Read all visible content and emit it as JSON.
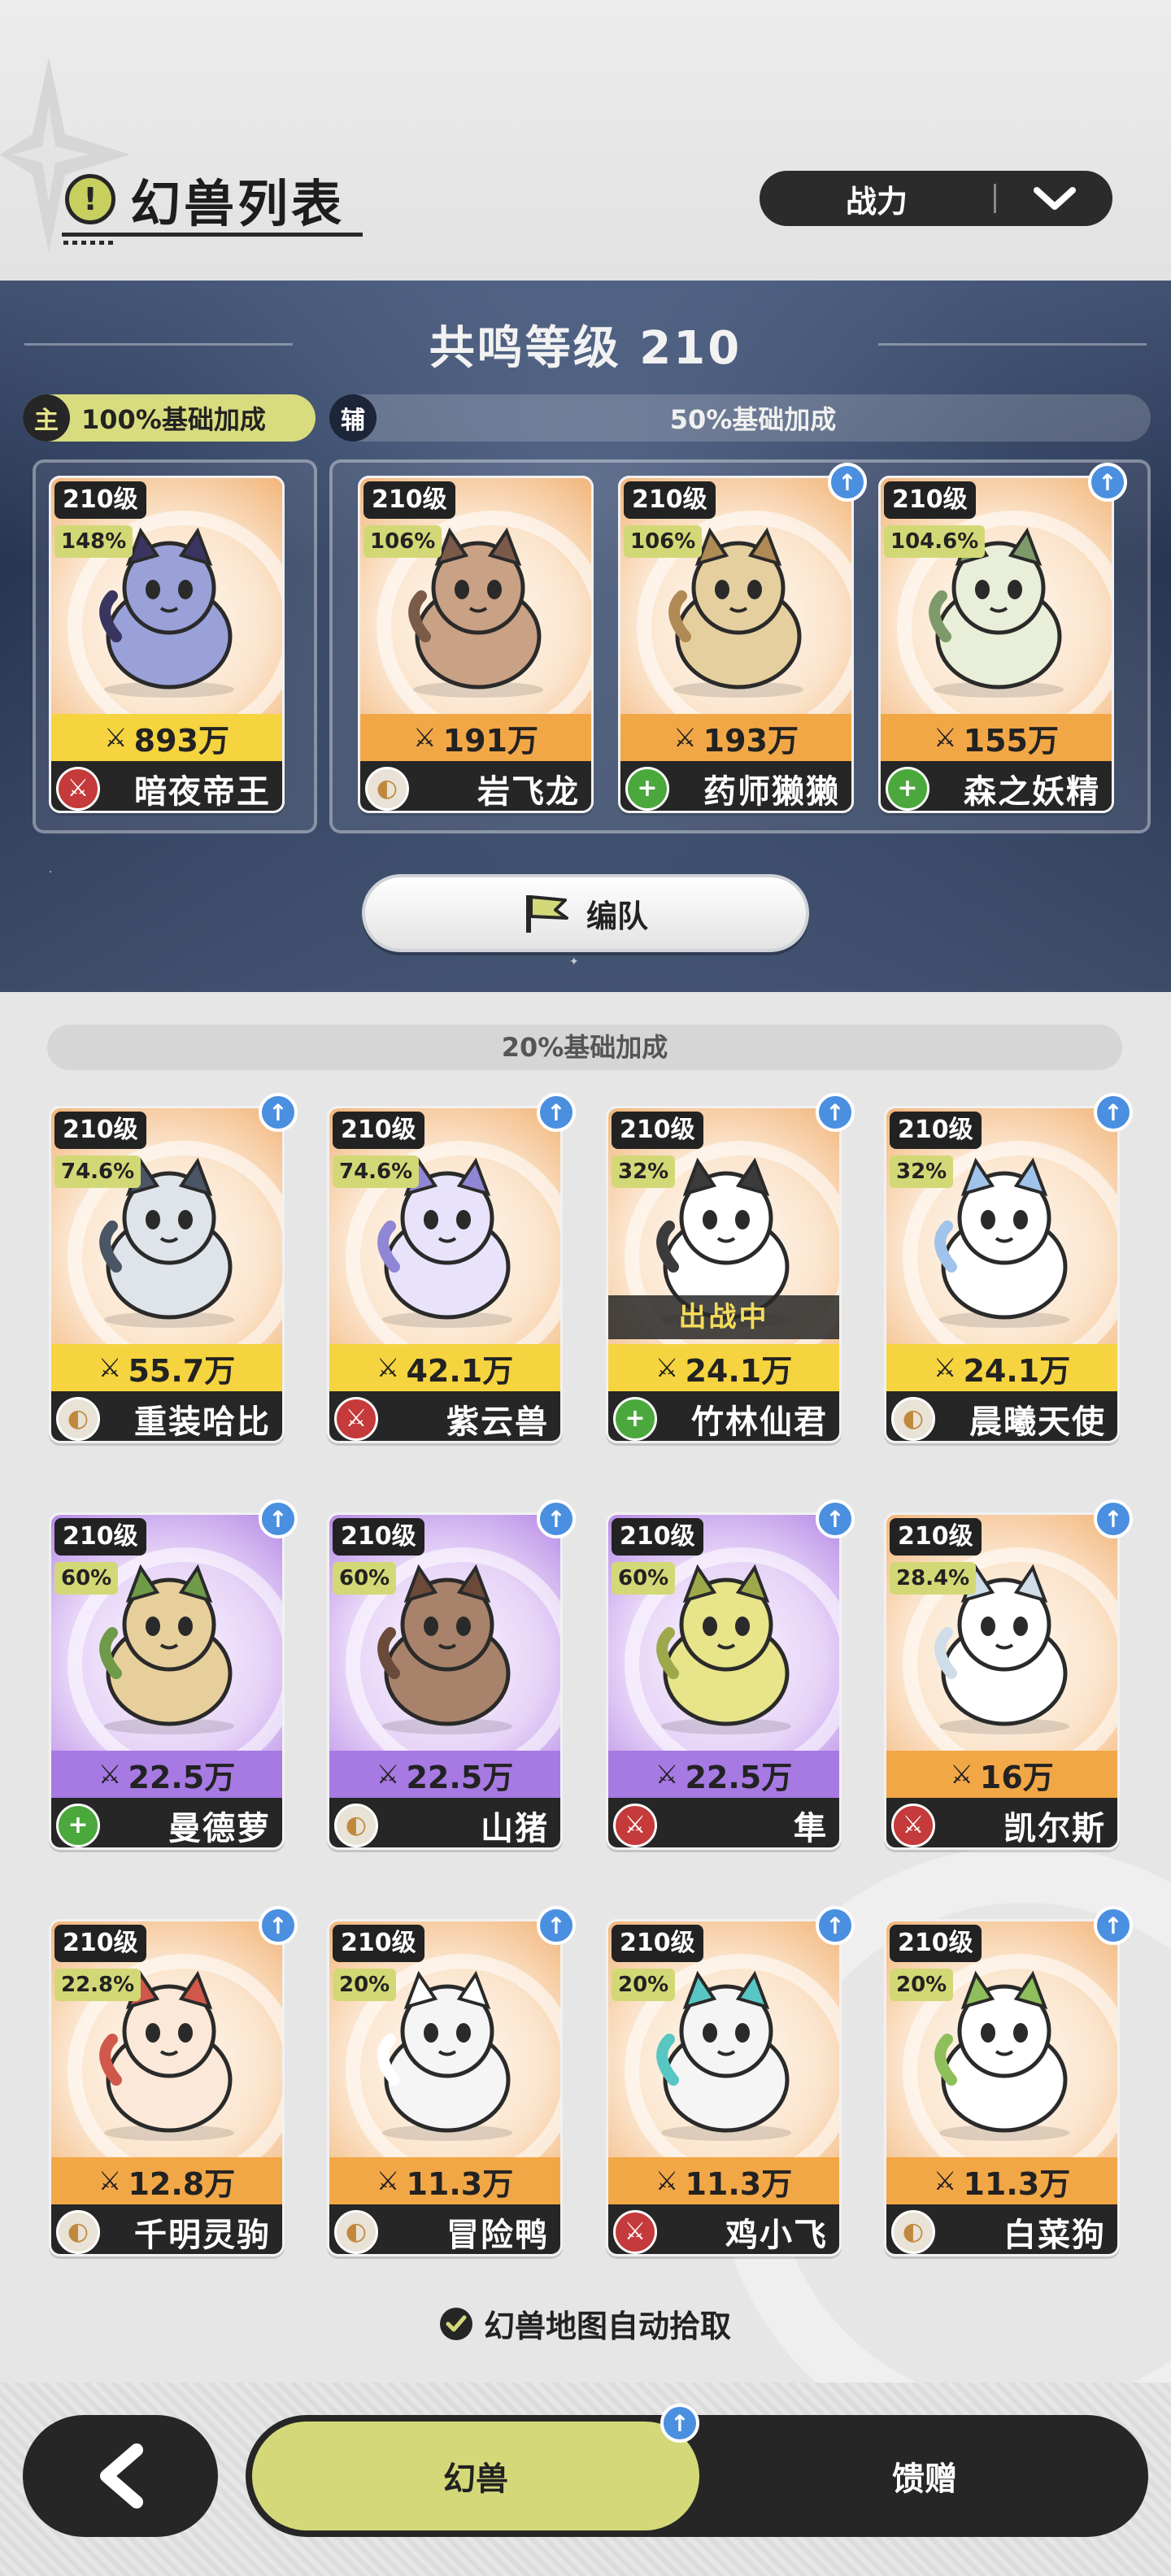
{
  "header": {
    "title": "幻兽列表",
    "info_icon": "exclamation-icon",
    "sort": {
      "label": "战力",
      "icon": "chevron-down-icon"
    }
  },
  "resonance": {
    "title": "共鸣等级 210",
    "main_tag": "主",
    "main_bonus": "100%基础加成",
    "aux_tag": "辅",
    "aux_bonus": "50%基础加成",
    "formation_label": "编队"
  },
  "main_pet": {
    "level": "210级",
    "pct": "148%",
    "power": "893万",
    "name": "暗夜帝王",
    "role": "atk",
    "band": "yellow",
    "bg": "orange",
    "up": false
  },
  "aux_pets": [
    {
      "level": "210级",
      "pct": "106%",
      "power": "191万",
      "name": "岩飞龙",
      "role": "def",
      "band": "orange",
      "bg": "orange",
      "up": false
    },
    {
      "level": "210级",
      "pct": "106%",
      "power": "193万",
      "name": "药师獭獭",
      "role": "heal",
      "band": "orange",
      "bg": "orange",
      "up": true
    },
    {
      "level": "210级",
      "pct": "104.6%",
      "power": "155万",
      "name": "森之妖精",
      "role": "heal",
      "band": "orange",
      "bg": "orange",
      "up": true
    }
  ],
  "reserve": {
    "bonus_label": "20%基础加成",
    "battle_label": "出战中",
    "pets": [
      {
        "level": "210级",
        "pct": "74.6%",
        "power": "55.7万",
        "name": "重装哈比",
        "role": "def",
        "band": "yellow",
        "bg": "orange",
        "up": true
      },
      {
        "level": "210级",
        "pct": "74.6%",
        "power": "42.1万",
        "name": "紫云兽",
        "role": "atk",
        "band": "yellow",
        "bg": "orange",
        "up": true
      },
      {
        "level": "210级",
        "pct": "32%",
        "power": "24.1万",
        "name": "竹林仙君",
        "role": "heal",
        "band": "yellow",
        "bg": "orange",
        "up": true,
        "in_battle": true
      },
      {
        "level": "210级",
        "pct": "32%",
        "power": "24.1万",
        "name": "晨曦天使",
        "role": "def",
        "band": "yellow",
        "bg": "orange",
        "up": true
      },
      {
        "level": "210级",
        "pct": "60%",
        "power": "22.5万",
        "name": "曼德萝",
        "role": "heal",
        "band": "purple",
        "bg": "purple",
        "up": true
      },
      {
        "level": "210级",
        "pct": "60%",
        "power": "22.5万",
        "name": "山猪",
        "role": "def",
        "band": "purple",
        "bg": "purple",
        "up": true
      },
      {
        "level": "210级",
        "pct": "60%",
        "power": "22.5万",
        "name": "隼",
        "role": "atk",
        "band": "purple",
        "bg": "purple",
        "up": true
      },
      {
        "level": "210级",
        "pct": "28.4%",
        "power": "16万",
        "name": "凯尔斯",
        "role": "atk",
        "band": "orange",
        "bg": "orange",
        "up": true
      },
      {
        "level": "210级",
        "pct": "22.8%",
        "power": "12.8万",
        "name": "千明灵驹",
        "role": "def",
        "band": "orange",
        "bg": "orange",
        "up": true
      },
      {
        "level": "210级",
        "pct": "20%",
        "power": "11.3万",
        "name": "冒险鸭",
        "role": "def",
        "band": "orange",
        "bg": "orange",
        "up": true
      },
      {
        "level": "210级",
        "pct": "20%",
        "power": "11.3万",
        "name": "鸡小飞",
        "role": "atk",
        "band": "orange",
        "bg": "orange",
        "up": true
      },
      {
        "level": "210级",
        "pct": "20%",
        "power": "11.3万",
        "name": "白菜狗",
        "role": "def",
        "band": "orange",
        "bg": "orange",
        "up": true
      }
    ]
  },
  "auto_pickup": {
    "label": "幻兽地图自动拾取",
    "checked": true
  },
  "footer": {
    "back_icon": "back-arrow-icon",
    "tabs": [
      {
        "label": "幻兽",
        "active": true,
        "badge": "upgrade-arrow-icon"
      },
      {
        "label": "馈赠",
        "active": false
      }
    ]
  },
  "colors": {
    "accent": "#d4d879",
    "dark": "#262626",
    "atk": "#c53a3a",
    "heal": "#4ba83c",
    "upgrade": "#4a8fe0"
  }
}
